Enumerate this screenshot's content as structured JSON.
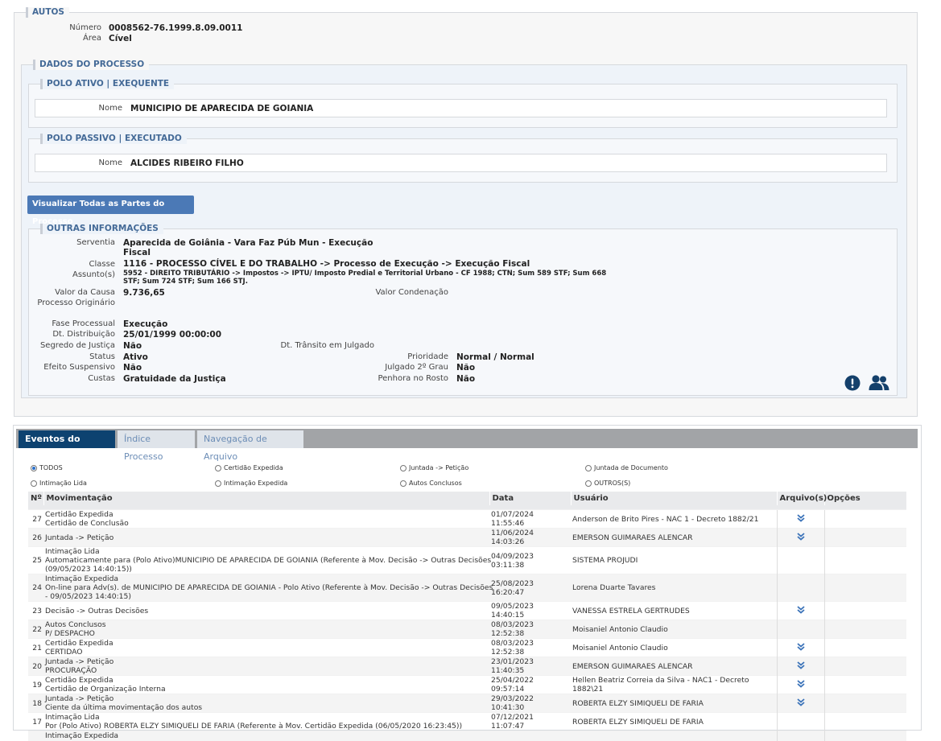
{
  "autos": {
    "legend": "AUTOS",
    "numero_label": "Número",
    "numero": "0008562-76.1999.8.09.0011",
    "area_label": "Área",
    "area": "Cível"
  },
  "dados": {
    "legend": "DADOS DO PROCESSO",
    "polo_ativo": {
      "legend": "POLO ATIVO | EXEQUENTE",
      "nome_label": "Nome",
      "nome": "MUNICIPIO DE APARECIDA DE GOIANIA"
    },
    "polo_passivo": {
      "legend": "POLO PASSIVO | EXECUTADO",
      "nome_label": "Nome",
      "nome": "ALCIDES RIBEIRO FILHO"
    },
    "btn_partes": "Visualizar Todas as Partes do Processo"
  },
  "outras": {
    "legend": "OUTRAS INFORMAÇÕES",
    "serventia_label": "Serventia",
    "serventia_1": "Aparecida de Goiânia - Vara Faz Púb Mun - Execução",
    "serventia_2": "Fiscal",
    "classe_label": "Classe",
    "classe": "1116 - PROCESSO CÍVEL E DO TRABALHO -> Processo de Execução -> Execução Fiscal",
    "assunto_label": "Assunto(s)",
    "assunto_1": "5952 - DIREITO TRIBUTÁRIO -> Impostos -> IPTU/ Imposto Predial e Territorial Urbano - CF 1988; CTN; Sum 589 STF; Sum 668",
    "assunto_2": "STF; Sum 724 STF; Sum 166 STJ.",
    "valor_causa_label": "Valor da Causa",
    "valor_causa": "9.736,65",
    "valor_condenacao_label": "Valor Condenação",
    "processo_originario_label": "Processo Originário",
    "fase_label": "Fase Processual",
    "fase": "Execução",
    "dt_dist_label": "Dt. Distribuição",
    "dt_dist": "25/01/1999 00:00:00",
    "segredo_label": "Segredo de Justiça",
    "segredo": "Não",
    "dt_transito_label": "Dt. Trânsito em Julgado",
    "status_label": "Status",
    "status": "Ativo",
    "prioridade_label": "Prioridade",
    "prioridade": "Normal / Normal",
    "efeito_label": "Efeito Suspensivo",
    "efeito": "Não",
    "julgado_label": "Julgado 2º Grau",
    "julgado": "Não",
    "custas_label": "Custas",
    "custas": "Gratuidade da Justiça",
    "penhora_label": "Penhora no Rosto",
    "penhora": "Não",
    "icons": [
      "alert-icon",
      "users-icon"
    ],
    "accent": "#14406b"
  },
  "tabs": [
    "Eventos do Processo",
    "Índice Processo",
    "Navegação de Arquivo"
  ],
  "filters": [
    {
      "label": "TODOS",
      "selected": true
    },
    {
      "label": "Certidão Expedida",
      "selected": false
    },
    {
      "label": "Juntada -> Petição",
      "selected": false
    },
    {
      "label": "Juntada de Documento",
      "selected": false
    },
    {
      "label": "Intimação Lida",
      "selected": false
    },
    {
      "label": "Intimação Expedida",
      "selected": false
    },
    {
      "label": "Autos Conclusos",
      "selected": false
    },
    {
      "label": "OUTROS(S)",
      "selected": false
    }
  ],
  "table": {
    "headers": [
      "Nº",
      "Movimentação",
      "Data",
      "Usuário",
      "Arquivo(s)",
      "Opções"
    ],
    "rows": [
      {
        "n": "27",
        "mov": [
          "Certidão Expedida",
          "Certidão de Conclusão"
        ],
        "data": "01/07/2024 11:55:46",
        "usuario": [
          "Anderson de Brito Pires - NAC 1 - Decreto 1882/21"
        ],
        "arquivo": true
      },
      {
        "n": "26",
        "mov": [
          "Juntada -> Petição"
        ],
        "data": "11/06/2024 14:03:26",
        "usuario": [
          "EMERSON GUIMARAES ALENCAR"
        ],
        "arquivo": true
      },
      {
        "n": "25",
        "mov": [
          "Intimação Lida",
          "Automaticamente para (Polo Ativo)MUNICIPIO DE APARECIDA DE GOIANIA (Referente à Mov. Decisão -> Outras Decisões",
          "(09/05/2023 14:40:15))"
        ],
        "data": "04/09/2023 03:11:38",
        "usuario": [
          "SISTEMA PROJUDI"
        ],
        "arquivo": false
      },
      {
        "n": "24",
        "mov": [
          "Intimação Expedida",
          "On-line para Adv(s). de MUNICIPIO DE APARECIDA DE GOIANIA - Polo Ativo (Referente à Mov. Decisão -> Outras Decisões",
          "- 09/05/2023 14:40:15)"
        ],
        "data": "25/08/2023 16:20:47",
        "usuario": [
          "Lorena Duarte Tavares"
        ],
        "arquivo": false
      },
      {
        "n": "23",
        "mov": [
          "Decisão -> Outras Decisões"
        ],
        "data": "09/05/2023 14:40:15",
        "usuario": [
          "VANESSA ESTRELA GERTRUDES"
        ],
        "arquivo": true
      },
      {
        "n": "22",
        "mov": [
          "Autos Conclusos",
          "P/ DESPACHO"
        ],
        "data": "08/03/2023 12:52:38",
        "usuario": [
          "Moisaniel Antonio Claudio"
        ],
        "arquivo": false
      },
      {
        "n": "21",
        "mov": [
          "Certidão Expedida",
          "CERTIDAO"
        ],
        "data": "08/03/2023 12:52:38",
        "usuario": [
          "Moisaniel Antonio Claudio"
        ],
        "arquivo": true
      },
      {
        "n": "20",
        "mov": [
          "Juntada -> Petição",
          "PROCURAÇÃO"
        ],
        "data": "23/01/2023 11:40:35",
        "usuario": [
          "EMERSON GUIMARAES ALENCAR"
        ],
        "arquivo": true
      },
      {
        "n": "19",
        "mov": [
          "Certidão Expedida",
          "Certidão de Organização Interna"
        ],
        "data": "25/04/2022 09:57:14",
        "usuario": [
          "Hellen Beatriz Correia da Silva - NAC1 - Decreto",
          "1882\\21"
        ],
        "arquivo": true
      },
      {
        "n": "18",
        "mov": [
          "Juntada -> Petição",
          "Ciente da última movimentação dos autos"
        ],
        "data": "29/03/2022 10:41:30",
        "usuario": [
          "ROBERTA ELZY SIMIQUELI DE FARIA"
        ],
        "arquivo": true
      },
      {
        "n": "17",
        "mov": [
          "Intimação Lida",
          "Por (Polo Ativo) ROBERTA ELZY SIMIQUELI DE FARIA (Referente à Mov. Certidão Expedida (06/05/2020 16:23:45))"
        ],
        "data": "07/12/2021 11:07:47",
        "usuario": [
          "ROBERTA ELZY SIMIQUELI DE FARIA"
        ],
        "arquivo": false
      },
      {
        "n": "",
        "mov": [
          "Intimação Expedida"
        ],
        "data": "",
        "usuario": [
          ""
        ],
        "arquivo": false
      }
    ]
  }
}
